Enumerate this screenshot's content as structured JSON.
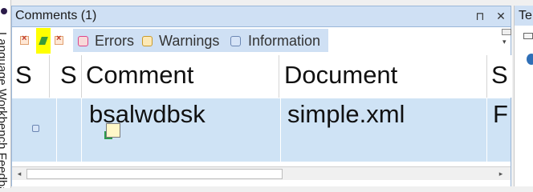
{
  "left_strip": {
    "vertical_text": "Language Workbench  Feedback"
  },
  "panel": {
    "title": "Comments (1)",
    "pin_glyph": "⊓",
    "close_glyph": "✕",
    "toolbar": {
      "clear_icon": "clear-icon",
      "edit_icon": "pencil-icon",
      "delete_icon": "delete-icon",
      "filters": [
        {
          "label": "Errors",
          "icon": "error-icon"
        },
        {
          "label": "Warnings",
          "icon": "warning-icon"
        },
        {
          "label": "Information",
          "icon": "info-icon"
        }
      ]
    },
    "grid": {
      "columns": [
        "S",
        "S",
        "Comment",
        "Document",
        "S"
      ],
      "rows": [
        {
          "severity_icon": "info-icon",
          "type_icon": "note-icon",
          "comment": "bsalwdbsk",
          "document": "simple.xml",
          "last": "F"
        }
      ]
    },
    "scrollbar": {
      "left_arrow": "◂",
      "right_arrow": "▸"
    }
  },
  "right_pane": {
    "title": "Te"
  },
  "colors": {
    "accent_header": "#cfe0f4",
    "row_selected": "#cfe3f5",
    "highlight": "#ffff00"
  }
}
